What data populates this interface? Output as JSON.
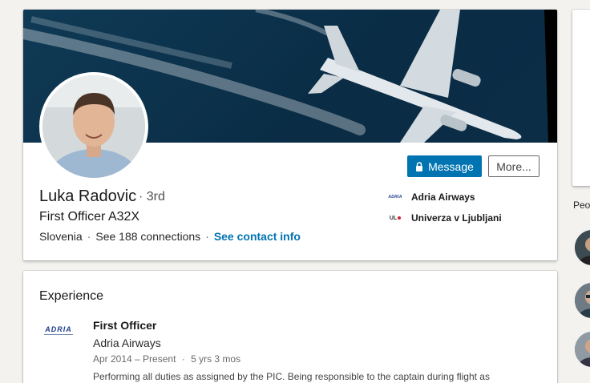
{
  "profile": {
    "name": "Luka Radovic",
    "degree": "· 3rd",
    "headline": "First Officer A32X",
    "location": "Slovenia",
    "connections": "See 188 connections",
    "contact_link": "See contact info"
  },
  "actions": {
    "message_label": "Message",
    "more_label": "More..."
  },
  "orgs": [
    {
      "name": "Adria Airways",
      "logo_text": "ADRIA"
    },
    {
      "name": "Univerza v Ljubljani",
      "logo_text": "UL"
    }
  ],
  "experience": {
    "section_title": "Experience",
    "items": [
      {
        "logo_text": "ADRIA",
        "title": "First Officer",
        "company": "Adria Airways",
        "dates": "Apr 2014 – Present",
        "duration": "5 yrs 3 mos",
        "description": "Performing all duties as assigned by the PIC. Being responsible to the captain during flight as"
      }
    ]
  },
  "sidebar": {
    "people_label": "Peo"
  },
  "colors": {
    "accent": "#0073b1",
    "banner": "#0f3a55",
    "page_bg": "#f3f2ef"
  }
}
